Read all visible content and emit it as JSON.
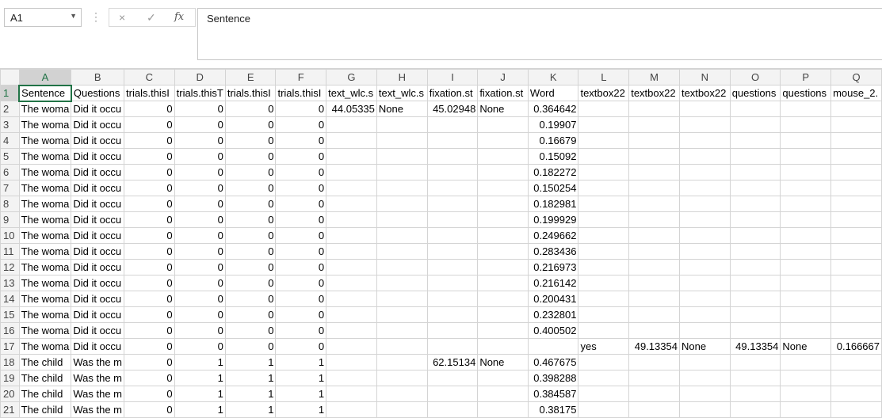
{
  "name_box": "A1",
  "formula_bar": {
    "cancel_icon": "×",
    "enter_icon": "✓",
    "fx_label": "fx",
    "content": "Sentence"
  },
  "columns": [
    "A",
    "B",
    "C",
    "D",
    "E",
    "F",
    "G",
    "H",
    "I",
    "J",
    "K",
    "L",
    "M",
    "N",
    "O",
    "P",
    "Q"
  ],
  "rows": [
    [
      "Sentence",
      "Questions",
      "trials.thisI",
      "trials.thisT",
      "trials.thisI",
      "trials.thisI",
      "text_wlc.s",
      "text_wlc.s",
      "fixation.st",
      "fixation.st",
      "Word",
      "textbox22",
      "textbox22",
      "textbox22",
      "questions",
      "questions",
      "mouse_2."
    ],
    [
      "The woma",
      "Did it occu",
      "0",
      "0",
      "0",
      "0",
      "44.05335",
      "None",
      "45.02948",
      "None",
      "0.364642",
      "",
      "",
      "",
      "",
      "",
      ""
    ],
    [
      "The woma",
      "Did it occu",
      "0",
      "0",
      "0",
      "0",
      "",
      "",
      "",
      "",
      "0.19907",
      "",
      "",
      "",
      "",
      "",
      ""
    ],
    [
      "The woma",
      "Did it occu",
      "0",
      "0",
      "0",
      "0",
      "",
      "",
      "",
      "",
      "0.16679",
      "",
      "",
      "",
      "",
      "",
      ""
    ],
    [
      "The woma",
      "Did it occu",
      "0",
      "0",
      "0",
      "0",
      "",
      "",
      "",
      "",
      "0.15092",
      "",
      "",
      "",
      "",
      "",
      ""
    ],
    [
      "The woma",
      "Did it occu",
      "0",
      "0",
      "0",
      "0",
      "",
      "",
      "",
      "",
      "0.182272",
      "",
      "",
      "",
      "",
      "",
      ""
    ],
    [
      "The woma",
      "Did it occu",
      "0",
      "0",
      "0",
      "0",
      "",
      "",
      "",
      "",
      "0.150254",
      "",
      "",
      "",
      "",
      "",
      ""
    ],
    [
      "The woma",
      "Did it occu",
      "0",
      "0",
      "0",
      "0",
      "",
      "",
      "",
      "",
      "0.182981",
      "",
      "",
      "",
      "",
      "",
      ""
    ],
    [
      "The woma",
      "Did it occu",
      "0",
      "0",
      "0",
      "0",
      "",
      "",
      "",
      "",
      "0.199929",
      "",
      "",
      "",
      "",
      "",
      ""
    ],
    [
      "The woma",
      "Did it occu",
      "0",
      "0",
      "0",
      "0",
      "",
      "",
      "",
      "",
      "0.249662",
      "",
      "",
      "",
      "",
      "",
      ""
    ],
    [
      "The woma",
      "Did it occu",
      "0",
      "0",
      "0",
      "0",
      "",
      "",
      "",
      "",
      "0.283436",
      "",
      "",
      "",
      "",
      "",
      ""
    ],
    [
      "The woma",
      "Did it occu",
      "0",
      "0",
      "0",
      "0",
      "",
      "",
      "",
      "",
      "0.216973",
      "",
      "",
      "",
      "",
      "",
      ""
    ],
    [
      "The woma",
      "Did it occu",
      "0",
      "0",
      "0",
      "0",
      "",
      "",
      "",
      "",
      "0.216142",
      "",
      "",
      "",
      "",
      "",
      ""
    ],
    [
      "The woma",
      "Did it occu",
      "0",
      "0",
      "0",
      "0",
      "",
      "",
      "",
      "",
      "0.200431",
      "",
      "",
      "",
      "",
      "",
      ""
    ],
    [
      "The woma",
      "Did it occu",
      "0",
      "0",
      "0",
      "0",
      "",
      "",
      "",
      "",
      "0.232801",
      "",
      "",
      "",
      "",
      "",
      ""
    ],
    [
      "The woma",
      "Did it occu",
      "0",
      "0",
      "0",
      "0",
      "",
      "",
      "",
      "",
      "0.400502",
      "",
      "",
      "",
      "",
      "",
      ""
    ],
    [
      "The woma",
      "Did it occu",
      "0",
      "0",
      "0",
      "0",
      "",
      "",
      "",
      "",
      "",
      "yes",
      "49.13354",
      "None",
      "49.13354",
      "None",
      "0.166667"
    ],
    [
      "The child",
      "Was the m",
      "0",
      "1",
      "1",
      "1",
      "",
      "",
      "62.15134",
      "None",
      "0.467675",
      "",
      "",
      "",
      "",
      "",
      ""
    ],
    [
      "The child",
      "Was the m",
      "0",
      "1",
      "1",
      "1",
      "",
      "",
      "",
      "",
      "0.398288",
      "",
      "",
      "",
      "",
      "",
      ""
    ],
    [
      "The child",
      "Was the m",
      "0",
      "1",
      "1",
      "1",
      "",
      "",
      "",
      "",
      "0.384587",
      "",
      "",
      "",
      "",
      "",
      ""
    ],
    [
      "The child",
      "Was the m",
      "0",
      "1",
      "1",
      "1",
      "",
      "",
      "",
      "",
      "0.38175",
      "",
      "",
      "",
      "",
      "",
      ""
    ]
  ],
  "numeric_columns": [
    2,
    3,
    4,
    5,
    6,
    8,
    10,
    12,
    14,
    16
  ]
}
